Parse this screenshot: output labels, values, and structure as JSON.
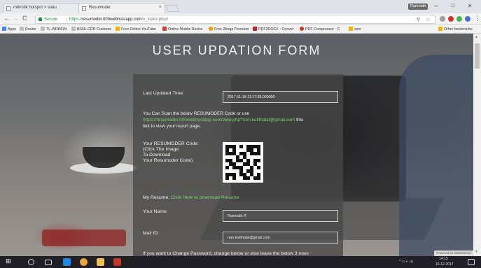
{
  "browser": {
    "tabs": [
      {
        "title": "mikrotik hotspot > statu",
        "close": "×"
      },
      {
        "title": "Resumoder",
        "close": "×"
      }
    ],
    "user_label": "Ramnath",
    "window_controls": {
      "minimize": "–",
      "maximize": "□",
      "close": "×"
    },
    "address": {
      "secure_label": "Secure",
      "url_scheme": "https://",
      "url_host": "resumoder.000webhostapp.com",
      "url_path": "/u_index.php#"
    },
    "bookmarks": [
      {
        "label": "Apps",
        "color": "#4285f4"
      },
      {
        "label": "Router",
        "color": "#9e9e9e"
      },
      {
        "label": "TL-WR841N",
        "color": "#9e9e9e"
      },
      {
        "label": "BSNL CDR Custome",
        "color": "#9e9e9e"
      },
      {
        "label": "Free Online YouTube",
        "color": "#f4b400"
      },
      {
        "label": "Online Mobile Recha",
        "color": "#d23f31"
      },
      {
        "label": "Free Zboga Premium",
        "color": "#f29900"
      },
      {
        "label": "PDF2DOCX - Conver",
        "color": "#c5221f"
      },
      {
        "label": "PDF Compressor - C",
        "color": "#d93025"
      },
      {
        "label": "sem",
        "color": "#f4b400"
      },
      {
        "label": "Other bookmarks",
        "color": "#f4b400"
      }
    ]
  },
  "page": {
    "title": "USER UPDATION FORM",
    "last_updated": {
      "label": "Last Updated Time:",
      "value": "2017-11-18 11:17:38.000000"
    },
    "scan_info": {
      "prefix": "You Can Scan the below RESUMODER Code or use",
      "link": "https://resumoder.000webhostapp.com/view.php?ram.kulithalai@gmail.com",
      "suffix_inline": "this",
      "suffix": "link to view your report page."
    },
    "qr_label": [
      "Your RESUMODER Code:",
      "(Click The Image",
      "To Download",
      "Your Resumoder Code)"
    ],
    "resume": {
      "label": "My Resume:",
      "link": "Click Here to download Resume"
    },
    "name": {
      "label": "Your Name:",
      "value": "Ramnath R"
    },
    "mail": {
      "label": "Mail ID:",
      "value": "ram.kulithalai@gmail.com"
    },
    "password_note": "If you want to Change Password, change below or else leave the below 3 rows",
    "password_note_mark": "*",
    "powered_by": "Powered by 000webhost"
  },
  "taskbar": {
    "time": "14:13",
    "date": "16-12-2017"
  }
}
